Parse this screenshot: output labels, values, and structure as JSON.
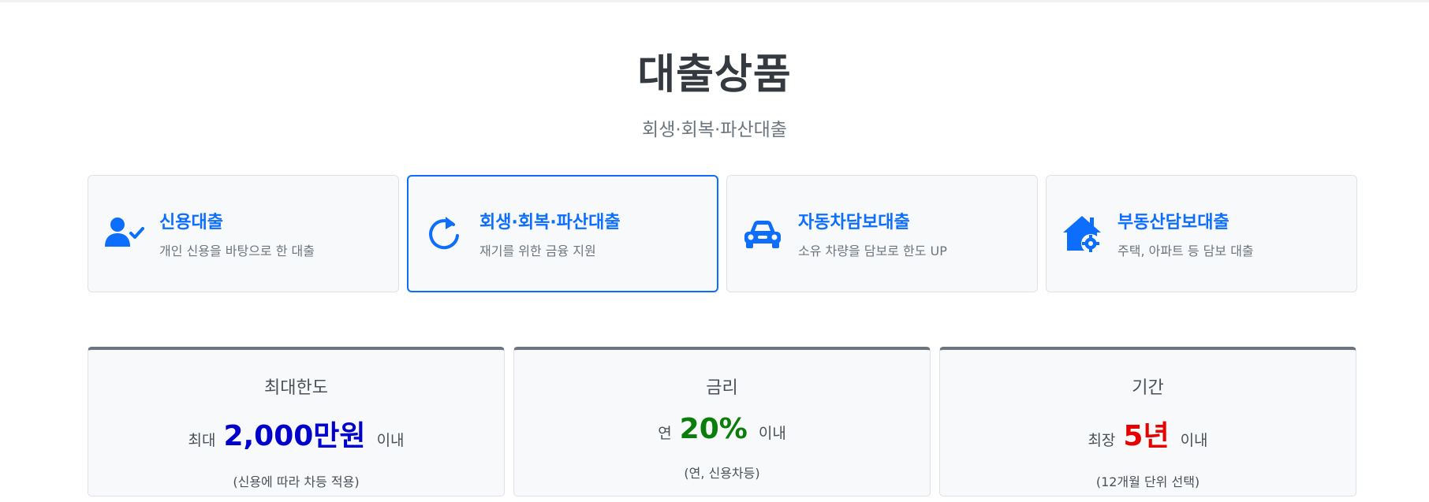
{
  "header": {
    "title": "대출상품",
    "subtitle": "회생·회복·파산대출"
  },
  "products": [
    {
      "title": "신용대출",
      "desc": "개인 신용을 바탕으로 한 대출",
      "icon": "user-check-icon"
    },
    {
      "title": "회생·회복·파산대출",
      "desc": "재기를 위한 금융 지원",
      "icon": "refresh-icon",
      "active": true
    },
    {
      "title": "자동차담보대출",
      "desc": "소유 차량을 담보로 한도 UP",
      "icon": "car-icon"
    },
    {
      "title": "부동산담보대출",
      "desc": "주택, 아파트 등 담보 대출",
      "icon": "house-gear-icon"
    }
  ],
  "stats": [
    {
      "label": "최대한도",
      "prefix": "최대",
      "value": "2,000만원",
      "suffix": "이내",
      "note": "(신용에 따라 차등 적용)",
      "color": "#0000cc"
    },
    {
      "label": "금리",
      "prefix": "연",
      "value": "20%",
      "suffix": "이내",
      "note": "(연, 신용차등)",
      "color": "#0a7d0a"
    },
    {
      "label": "기간",
      "prefix": "최장",
      "value": "5년",
      "suffix": "이내",
      "note": "(12개월 단위 선택)",
      "color": "#e60000"
    }
  ],
  "colors": {
    "accent": "#0d6efd",
    "card_bg": "#f8f9fa",
    "stat_top_border": "#6c757d"
  }
}
